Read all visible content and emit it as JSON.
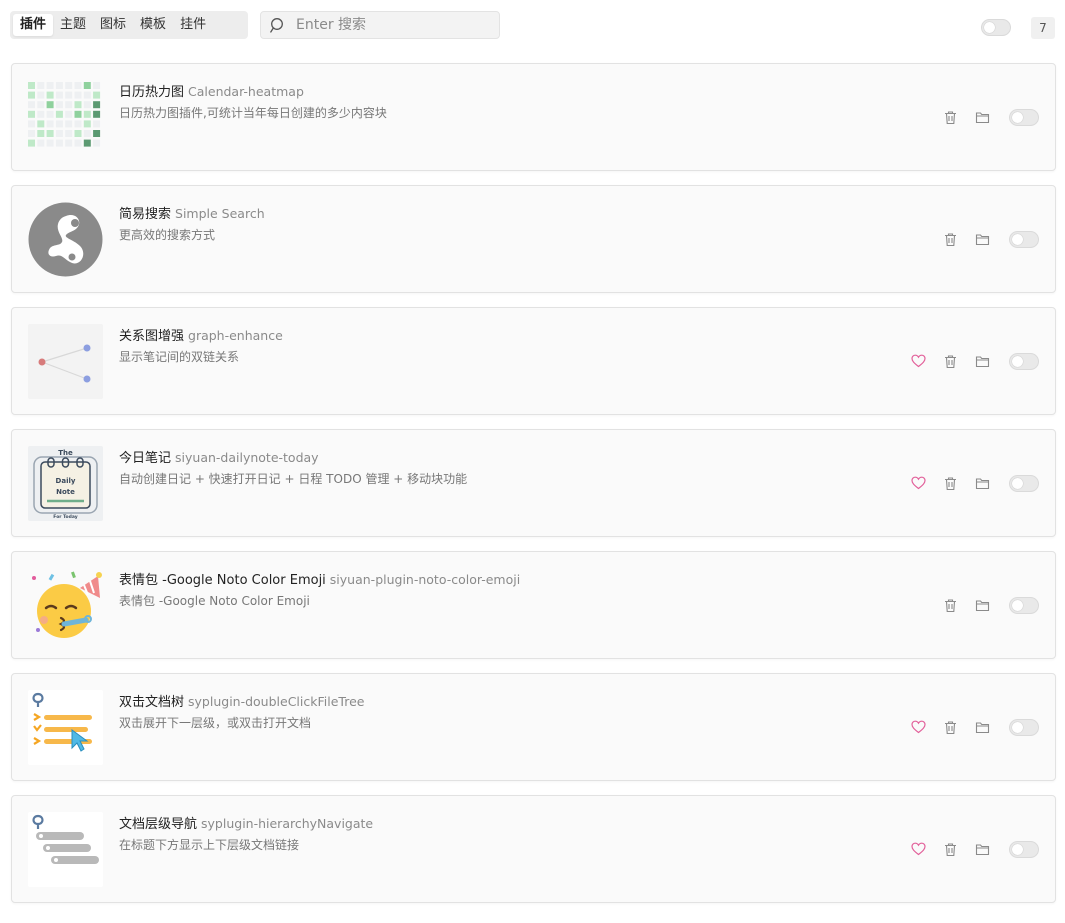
{
  "tabs": [
    "插件",
    "主题",
    "图标",
    "模板",
    "挂件"
  ],
  "search": {
    "placeholder": "Enter 搜索",
    "value": ""
  },
  "count": "7",
  "colors": {
    "heart": "#e2609a",
    "icon": "#8a8a8a",
    "heatmap_dark": "#5c9a72",
    "heatmap_light": "#bfe9c8"
  },
  "plugins": [
    {
      "name": "日历热力图",
      "package": "Calendar-heatmap",
      "description": "日历热力图插件,可统计当年每日创建的多少内容块",
      "favorite": false,
      "icon": "heatmap-icon"
    },
    {
      "name": "简易搜索",
      "package": "Simple Search",
      "description": "更高效的搜索方式",
      "favorite": false,
      "icon": "simple-search-logo"
    },
    {
      "name": "关系图增强",
      "package": "graph-enhance",
      "description": "显示笔记间的双链关系",
      "favorite": true,
      "icon": "graph-icon"
    },
    {
      "name": "今日笔记",
      "package": "siyuan-dailynote-today",
      "description": "自动创建日记 + 快速打开日记 + 日程 TODO 管理 + 移动块功能",
      "favorite": true,
      "icon": "daily-note-icon",
      "thumb_text": {
        "the": "The",
        "daily": "Daily",
        "note": "Note",
        "for_today": "For Today"
      }
    },
    {
      "name": "表情包 -Google Noto Color Emoji",
      "package": "siyuan-plugin-noto-color-emoji",
      "description": "表情包 -Google Noto Color Emoji",
      "favorite": false,
      "icon": "party-emoji-icon"
    },
    {
      "name": "双击文档树",
      "package": "syplugin-doubleClickFileTree",
      "description": "双击展开下一层级，或双击打开文档",
      "favorite": true,
      "icon": "double-click-tree-icon"
    },
    {
      "name": "文档层级导航",
      "package": "syplugin-hierarchyNavigate",
      "description": "在标题下方显示上下层级文档链接",
      "favorite": true,
      "icon": "hierarchy-nav-icon"
    }
  ]
}
